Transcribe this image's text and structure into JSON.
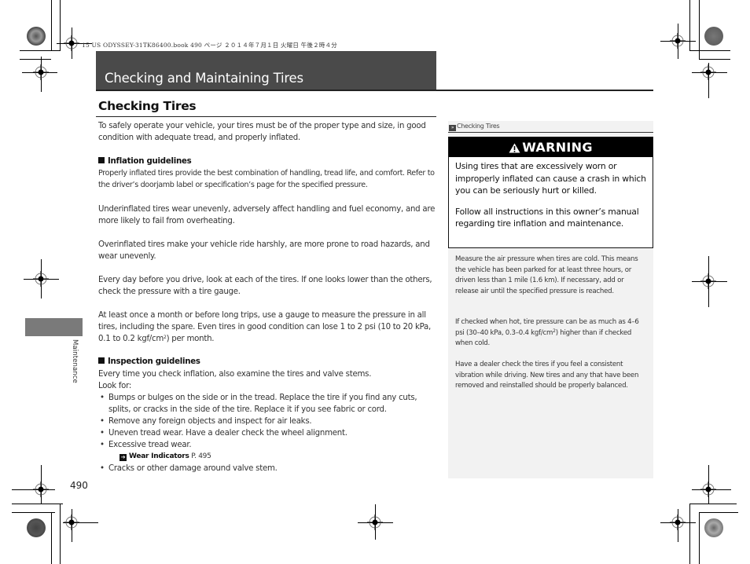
{
  "print_header": {
    "file_info": "15 US ODYSSEY-31TK86400.book  490 ページ  ２０１４年７月１日  火曜日  午後２時４分"
  },
  "chapter": {
    "title": "Checking and Maintaining Tires"
  },
  "section": {
    "title": "Checking Tires",
    "intro": "To safely operate your vehicle, your tires must be of the proper type and size, in good condition with adequate tread, and properly inflated.",
    "inflation": {
      "heading": "Inflation guidelines",
      "paragraphs": [
        "Properly inflated tires provide the best combination of handling, tread life, and comfort. Refer to the driver’s doorjamb label or specification’s page for the specified pressure.",
        "Underinflated tires wear unevenly, adversely affect handling and fuel economy, and are more likely to fail from overheating.",
        "Overinflated tires make your vehicle ride harshly, are more prone to road hazards, and wear unevenly.",
        "Every day before you drive, look at each of the tires. If one looks lower than the others, check the pressure with a tire gauge."
      ],
      "monthly_check": "At least once a month or before long trips, use a gauge to measure the pressure in all tires, including the spare. Even tires in good condition can lose 1 to 2 psi (10 to 20 kPa, 0.1 to 0.2 kgf/cm",
      "monthly_check_sup": "2",
      "monthly_check_end": ") per month."
    },
    "inspection": {
      "heading": "Inspection guidelines",
      "intro": "Every time you check inflation, also examine the tires and valve stems.",
      "look_for": "Look for:",
      "items": [
        "Bumps or bulges on the side or in the tread. Replace the tire if you find any cuts, splits, or cracks in the side of the tire. Replace it if you see fabric or cord.",
        "Remove any foreign objects and inspect for air leaks.",
        "Uneven tread wear. Have a dealer check the wheel alignment.",
        "Excessive tread wear.",
        "Cracks or other damage around valve stem."
      ],
      "xref": {
        "title": "Wear Indicators",
        "page": "P. 495"
      }
    }
  },
  "sidebar": {
    "tab_label": "Maintenance",
    "page_number": "490"
  },
  "notes": {
    "ref_label": "Checking Tires",
    "warning": {
      "heading": "WARNING",
      "paragraphs": [
        "Using tires that are excessively worn or improperly inflated can cause a crash in which you can be seriously hurt or killed.",
        "Follow all instructions in this owner’s manual regarding tire inflation and maintenance."
      ]
    },
    "paragraphs": [
      "Measure the air pressure when tires are cold. This means the vehicle has been parked for at least three hours, or driven less than 1 mile (1.6 km). If necessary, add or release air until the specified pressure is reached.",
      "Have a dealer check the tires if you feel a consistent vibration while driving. New tires and any that have been removed and reinstalled should be properly balanced."
    ],
    "hot_check": "If checked when hot, tire pressure can be as much as 4–6 psi (30–40 kPa, 0.3–0.4 kgf/cm",
    "hot_check_sup": "2",
    "hot_check_end": ") higher than if checked when cold."
  }
}
